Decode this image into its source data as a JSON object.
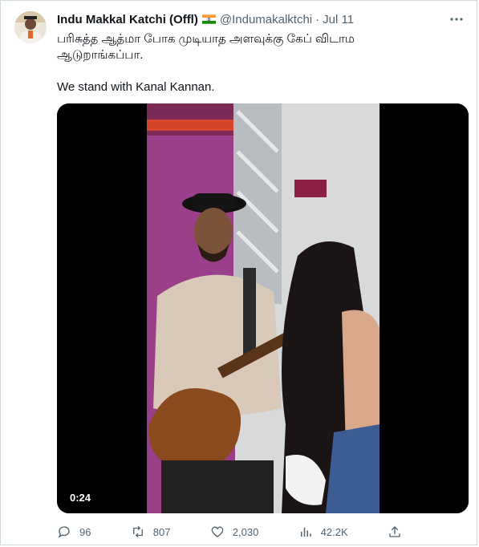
{
  "tweet": {
    "author_name": "Indu Makkal Katchi (Offl)",
    "handle": "@Indumakalktchi",
    "separator": "·",
    "date": "Jul 11",
    "text_line_1": "பரிசுத்த ஆத்மா போக முடியாத அளவுக்கு கேப் விடாம",
    "text_line_2": "ஆடுறாங்கப்பா.",
    "text_line_3": "We stand with Kanal Kannan.",
    "video_duration": "0:24"
  },
  "actions": {
    "replies": "96",
    "retweets": "807",
    "likes": "2,030",
    "views": "42.2K"
  },
  "colors": {
    "text": "#0f1419",
    "secondary": "#536471",
    "border": "#cfd9de",
    "flag_saffron": "#ff9933",
    "flag_green": "#138808"
  },
  "icons": [
    "more-icon",
    "reply-icon",
    "retweet-icon",
    "like-icon",
    "views-icon",
    "share-icon",
    "india-flag-icon"
  ]
}
